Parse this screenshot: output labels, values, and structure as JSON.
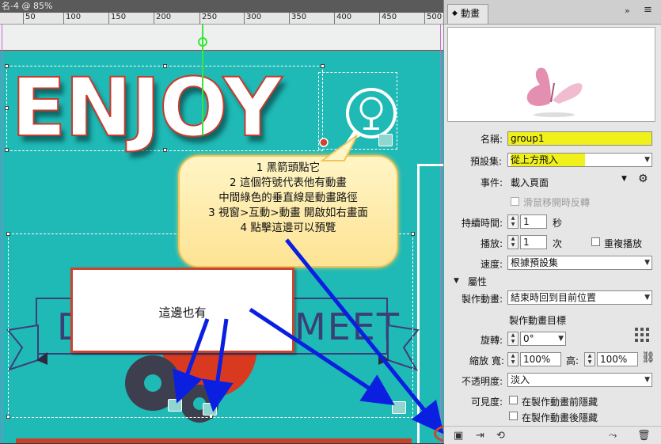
{
  "document": {
    "tab_title": "名-4 @ 85%",
    "ruler_ticks": [
      "50",
      "100",
      "150",
      "200",
      "250",
      "300",
      "350",
      "400",
      "450",
      "500"
    ]
  },
  "artwork": {
    "headline": "ENJOY",
    "ribbon_text_left": "D",
    "ribbon_text_right": "MEET"
  },
  "callout_main": {
    "lines": [
      "1 黑箭頭點它",
      "2 這個符號代表他有動畫",
      "中間綠色的垂直線是動畫路徑",
      "3 視窗>互動>動畫 開啟如右畫面",
      "4 點擊這邊可以預覽"
    ]
  },
  "callout_small": {
    "text": "這邊也有"
  },
  "panel": {
    "tab_label": "動畫",
    "menu_glyph": "»",
    "menu_glyph2": "≡",
    "name_label": "名稱:",
    "name_value": "group1",
    "preset_label": "預設集:",
    "preset_value": "從上方飛入",
    "event_label": "事件:",
    "event_value": "載入頁面",
    "rollover_label": "滑鼠移開時反轉",
    "duration_label": "持續時間:",
    "duration_value": "1",
    "duration_unit": "秒",
    "play_label": "播放:",
    "play_value": "1",
    "play_unit": "次",
    "loop_label": "重複播放",
    "speed_label": "速度:",
    "speed_value": "根據預設集",
    "properties_label": "屬性",
    "animate_label": "製作動畫:",
    "animate_value": "結束時回到目前位置",
    "target_label": "製作動畫目標",
    "rotate_label": "旋轉:",
    "rotate_value": "0°",
    "scale_label": "縮放 寬:",
    "scale_w_value": "100%",
    "height_label": "高:",
    "scale_h_value": "100%",
    "opacity_label": "不透明度:",
    "opacity_value": "淡入",
    "visibility_label": "可見度:",
    "visibility_before": "在製作動畫前隱藏",
    "visibility_after": "在製作動畫後隱藏"
  },
  "colors": {
    "canvas_teal": "#1fb9b6",
    "highlight_yellow": "#f0f01a",
    "arrow_blue": "#0a1fe0",
    "accent_red": "#d1432d"
  }
}
